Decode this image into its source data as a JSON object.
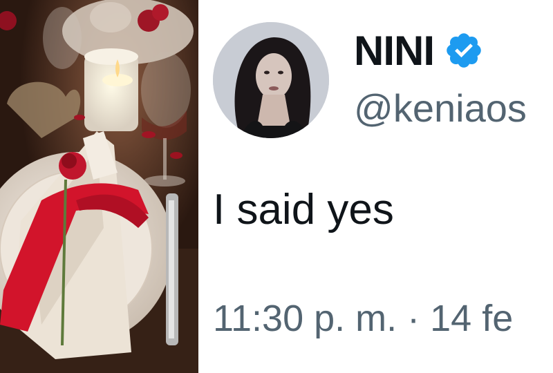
{
  "tweet": {
    "display_name": "NINI",
    "handle": "@keniaos",
    "text": "I said yes",
    "timestamp": "11:30 p. m. · 14 fe",
    "verified": true
  },
  "photo": {
    "subject": "romantic table setting with candle, rose and red ribbon on napkin"
  },
  "colors": {
    "verified_badge": "#1d9bf0",
    "name_text": "#0f1419",
    "secondary_text": "#536471",
    "ribbon": "#d2142b"
  }
}
